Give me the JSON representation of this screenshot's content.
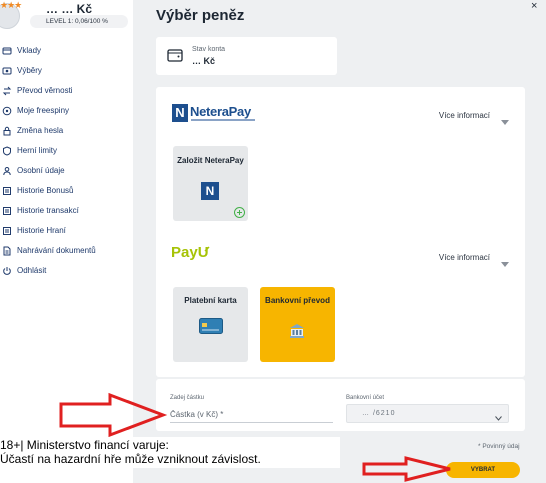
{
  "sidebar": {
    "balance": "… … Kč",
    "level": "LEVEL 1: 0,06/100 %",
    "items": [
      {
        "label": "Vklady",
        "icon": "deposit-icon"
      },
      {
        "label": "Výběry",
        "icon": "withdrawal-icon"
      },
      {
        "label": "Převod věrnosti",
        "icon": "loyalty-transfer-icon"
      },
      {
        "label": "Moje freespiny",
        "icon": "freespins-icon"
      },
      {
        "label": "Změna hesla",
        "icon": "lock-icon"
      },
      {
        "label": "Herní limity",
        "icon": "limits-icon"
      },
      {
        "label": "Osobní údaje",
        "icon": "user-icon"
      },
      {
        "label": "Historie Bonusů",
        "icon": "bonus-history-icon"
      },
      {
        "label": "Historie transakcí",
        "icon": "transactions-history-icon"
      },
      {
        "label": "Historie Hraní",
        "icon": "game-history-icon"
      },
      {
        "label": "Nahrávání dokumentů",
        "icon": "document-upload-icon"
      },
      {
        "label": "Odhlásit",
        "icon": "logout-icon"
      }
    ]
  },
  "main": {
    "title": "Výběr peněz",
    "close": "×",
    "balance_label": "Stav konta",
    "balance_value": "… Kč"
  },
  "methods": {
    "neterapay": {
      "logo": "NeteraPay",
      "more_info": "Více informací",
      "tile_label": "Založit NeteraPay"
    },
    "payu": {
      "logo": "PayU",
      "more_info": "Více informací",
      "card_label": "Platební karta",
      "transfer_label": "Bankovní převod"
    }
  },
  "form": {
    "amount_label": "Zadej částku",
    "amount_placeholder": "Částka (v Kč) *",
    "bank_account_label": "Bankovní účet",
    "bank_account_value": "… /6210",
    "required_note": "* Povinný údaj",
    "withdraw_label": "VYBRAT"
  },
  "warning": {
    "line1": "18+| Ministerstvo financí varuje:",
    "line2": "Účastí na hazardní hře může vzniknout závislost."
  },
  "colors": {
    "accent": "#f7b500",
    "nav_text": "#1f3a6b",
    "annotation_arrow": "#e02020"
  }
}
